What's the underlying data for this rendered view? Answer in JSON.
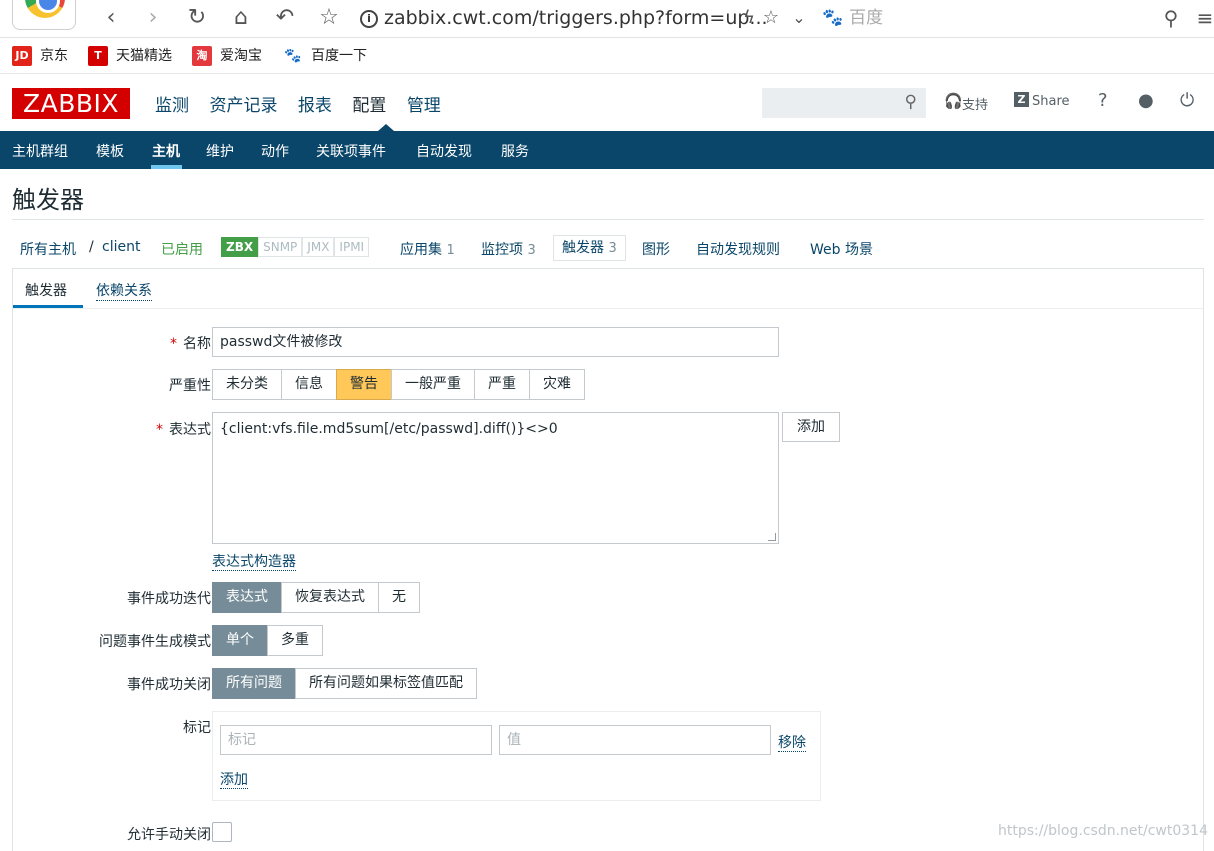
{
  "browser": {
    "url": "zabbix.cwt.com/triggers.php?form=up...",
    "search_engine": "百度",
    "bookmarks": [
      {
        "label": "京东",
        "icon_text": "JD",
        "color": "#e2231a"
      },
      {
        "label": "天猫精选",
        "icon_text": "T",
        "color": "#d40000"
      },
      {
        "label": "爱淘宝",
        "icon_text": "淘",
        "color": "#e4393c"
      },
      {
        "label": "百度一下",
        "icon_text": "🐾",
        "color": "#2f6fd6"
      }
    ]
  },
  "logo": "ZABBIX",
  "main_menu": [
    "监测",
    "资产记录",
    "报表",
    "配置",
    "管理"
  ],
  "header_links": {
    "support": "支持",
    "share": "Share",
    "help": "?"
  },
  "sub_menu": [
    "主机群组",
    "模板",
    "主机",
    "维护",
    "动作",
    "关联项事件",
    "自动发现",
    "服务"
  ],
  "page_title": "触发器",
  "breadcrumbs": {
    "all_hosts": "所有主机",
    "sep": "/",
    "host": "client",
    "status": "已启用",
    "availability": [
      "ZBX",
      "SNMP",
      "JMX",
      "IPMI"
    ],
    "applications": "应用集",
    "applications_count": "1",
    "items": "监控项",
    "items_count": "3",
    "triggers": "触发器",
    "triggers_count": "3",
    "graphs": "图形",
    "discovery": "自动发现规则",
    "web": "Web 场景"
  },
  "tabs": [
    "触发器",
    "依赖关系"
  ],
  "form": {
    "name_label": "名称",
    "name_value": "passwd文件被修改",
    "severity_label": "严重性",
    "severity_options": [
      "未分类",
      "信息",
      "警告",
      "一般严重",
      "严重",
      "灾难"
    ],
    "severity_selected": "警告",
    "expression_label": "表达式",
    "expression_value": "{client:vfs.file.md5sum[/etc/passwd].diff()}<>0",
    "add_button": "添加",
    "expression_builder": "表达式构造器",
    "ok_event_label": "事件成功迭代",
    "ok_event_options": [
      "表达式",
      "恢复表达式",
      "无"
    ],
    "problem_mode_label": "问题事件生成模式",
    "problem_mode_options": [
      "单个",
      "多重"
    ],
    "ok_close_label": "事件成功关闭",
    "ok_close_options": [
      "所有问题",
      "所有问题如果标签值匹配"
    ],
    "tags_label": "标记",
    "tag_placeholder": "标记",
    "value_placeholder": "值",
    "remove_link": "移除",
    "add_link": "添加",
    "manual_close_label": "允许手动关闭"
  },
  "watermark": "https://blog.csdn.net/cwt0314"
}
